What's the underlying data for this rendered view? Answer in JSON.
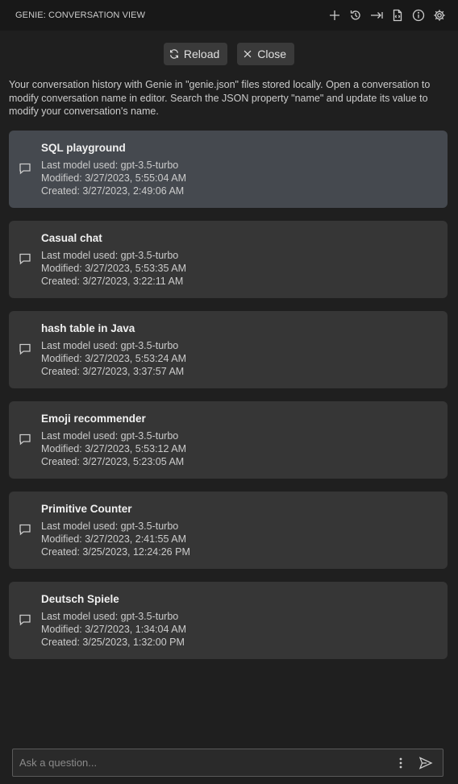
{
  "window": {
    "title": "GENIE: CONVERSATION VIEW"
  },
  "toolbar": {
    "icons": [
      "plus-icon",
      "history-icon",
      "arrow-right-to-bar-icon",
      "json-file-icon",
      "info-icon",
      "gear-icon"
    ]
  },
  "actions": {
    "reload_label": "Reload",
    "close_label": "Close"
  },
  "intro": "Your conversation history with Genie in \"genie.json\" files stored locally. Open a conversation to modify conversation name in editor. Search the JSON property \"name\" and update its value to modify your conversation's name.",
  "conversations": [
    {
      "name": "SQL playground",
      "model": "Last model used: gpt-3.5-turbo",
      "modified": "Modified: 3/27/2023, 5:55:04 AM",
      "created": "Created: 3/27/2023, 2:49:06 AM"
    },
    {
      "name": "Casual chat",
      "model": "Last model used: gpt-3.5-turbo",
      "modified": "Modified: 3/27/2023, 5:53:35 AM",
      "created": "Created: 3/27/2023, 3:22:11 AM"
    },
    {
      "name": "hash table in Java",
      "model": "Last model used: gpt-3.5-turbo",
      "modified": "Modified: 3/27/2023, 5:53:24 AM",
      "created": "Created: 3/27/2023, 3:37:57 AM"
    },
    {
      "name": "Emoji recommender",
      "model": "Last model used: gpt-3.5-turbo",
      "modified": "Modified: 3/27/2023, 5:53:12 AM",
      "created": "Created: 3/27/2023, 5:23:05 AM"
    },
    {
      "name": "Primitive Counter",
      "model": "Last model used: gpt-3.5-turbo",
      "modified": "Modified: 3/27/2023, 2:41:55 AM",
      "created": "Created: 3/25/2023, 12:24:26 PM"
    },
    {
      "name": "Deutsch Spiele",
      "model": "Last model used: gpt-3.5-turbo",
      "modified": "Modified: 3/27/2023, 1:34:04 AM",
      "created": "Created: 3/25/2023, 1:32:00 PM"
    }
  ],
  "input": {
    "placeholder": "Ask a question...",
    "value": ""
  },
  "colors": {
    "background": "#1f1f1f",
    "card": "#363636",
    "card_active": "#45494f",
    "button": "#3a3a3a"
  }
}
